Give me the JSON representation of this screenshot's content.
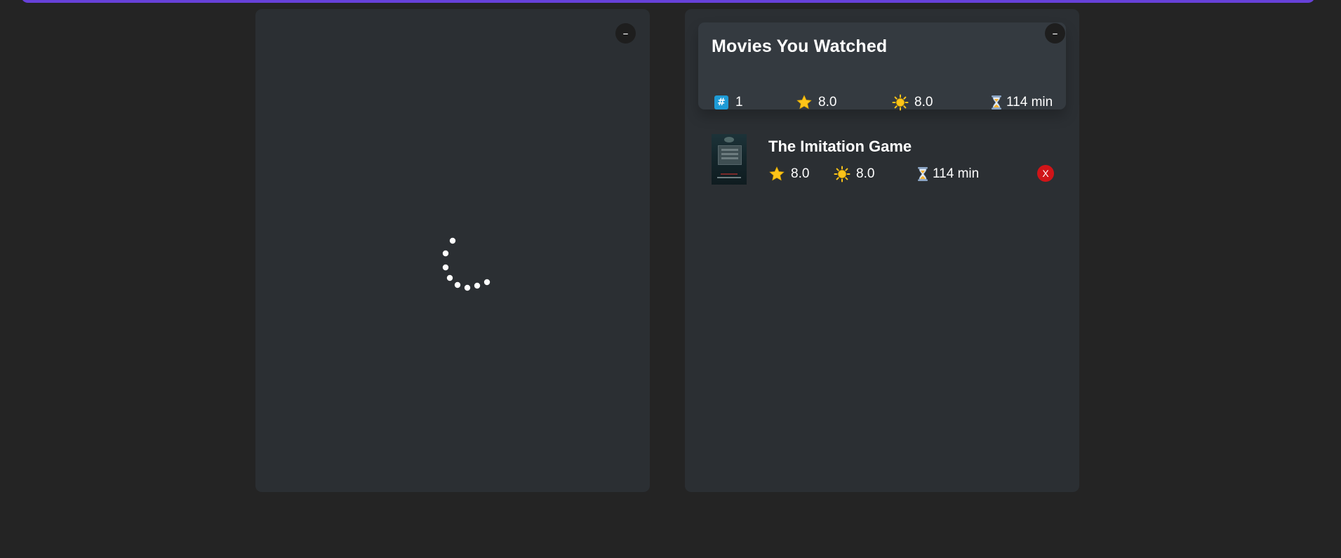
{
  "colors": {
    "accent": "#6741d9",
    "background": "#242424",
    "box": "#2b2f33",
    "summary": "#343a40",
    "delete": "#d01418",
    "star": "#fcc419"
  },
  "left_panel": {
    "toggle_label": "–",
    "state": "loading"
  },
  "right_panel": {
    "toggle_label": "–",
    "summary": {
      "title": "Movies You Watched",
      "count": "1",
      "avg_imdb_rating": "8.0",
      "avg_user_rating": "8.0",
      "avg_runtime": "114 min",
      "icons": [
        "hash-icon",
        "star-icon",
        "glowing-star-icon",
        "hourglass-icon"
      ]
    },
    "watched": [
      {
        "title": "The Imitation Game",
        "imdb_rating": "8.0",
        "user_rating": "8.0",
        "runtime": "114 min",
        "delete_label": "X"
      }
    ]
  }
}
